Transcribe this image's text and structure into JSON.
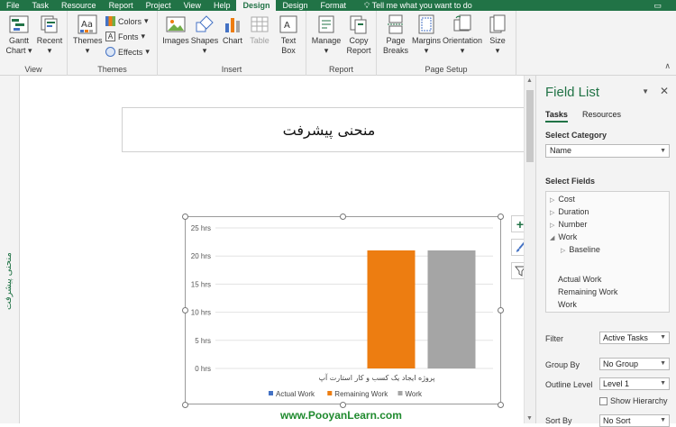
{
  "tabs": [
    "File",
    "Task",
    "Resource",
    "Report",
    "Project",
    "View",
    "Help",
    "Design",
    "Design",
    "Format"
  ],
  "active_tab_index": 7,
  "tell_me": "Tell me what you want to do",
  "ribbon": {
    "view": {
      "label": "View",
      "gantt_chart": "Gantt Chart",
      "recent": "Recent"
    },
    "themes": {
      "label": "Themes",
      "themes": "Themes",
      "colors": "Colors",
      "fonts": "Fonts",
      "effects": "Effects"
    },
    "insert": {
      "label": "Insert",
      "images": "Images",
      "shapes": "Shapes",
      "chart": "Chart",
      "table": "Table",
      "text_box": "Text Box"
    },
    "report": {
      "label": "Report",
      "manage": "Manage",
      "copy_report": "Copy Report"
    },
    "page_setup": {
      "label": "Page Setup",
      "page_breaks": "Page Breaks",
      "margins": "Margins",
      "orientation": "Orientation",
      "size": "Size"
    }
  },
  "left_strip_label": "منحنی پیشرفت",
  "report_title": "منحنی پیشرفت",
  "chart_data": {
    "type": "bar",
    "ylim": [
      0,
      25
    ],
    "yticks": [
      "0 hrs",
      "5 hrs",
      "10 hrs",
      "15 hrs",
      "20 hrs",
      "25 hrs"
    ],
    "categories": [
      "پروژه ایجاد یک کسب و کار استارت آپ"
    ],
    "series": [
      {
        "name": "Actual Work",
        "values": [
          0
        ],
        "color": "#4472c4"
      },
      {
        "name": "Remaining Work",
        "values": [
          21
        ],
        "color": "#ed7d11"
      },
      {
        "name": "Work",
        "values": [
          21
        ],
        "color": "#a5a5a5"
      }
    ],
    "legend": "bottom",
    "grid": true
  },
  "watermark": "www.PooyanLearn.com",
  "field_list": {
    "title": "Field List",
    "tabs": [
      "Tasks",
      "Resources"
    ],
    "select_category_label": "Select Category",
    "category_value": "Name",
    "select_fields_label": "Select Fields",
    "fields": [
      {
        "label": "Cost",
        "toggle": "▷"
      },
      {
        "label": "Duration",
        "toggle": "▷"
      },
      {
        "label": "Number",
        "toggle": "▷"
      },
      {
        "label": "Work",
        "toggle": "◢"
      },
      {
        "label": "Baseline",
        "toggle": "▷"
      }
    ],
    "selected_fields": [
      "Actual Work",
      "Remaining Work",
      "Work"
    ],
    "filter_label": "Filter",
    "filter_value": "Active Tasks",
    "group_by_label": "Group By",
    "group_by_value": "No Group",
    "outline_level_label": "Outline Level",
    "outline_level_value": "Level 1",
    "show_hierarchy": "Show Hierarchy",
    "sort_by_label": "Sort By",
    "sort_by_value": "No Sort"
  }
}
